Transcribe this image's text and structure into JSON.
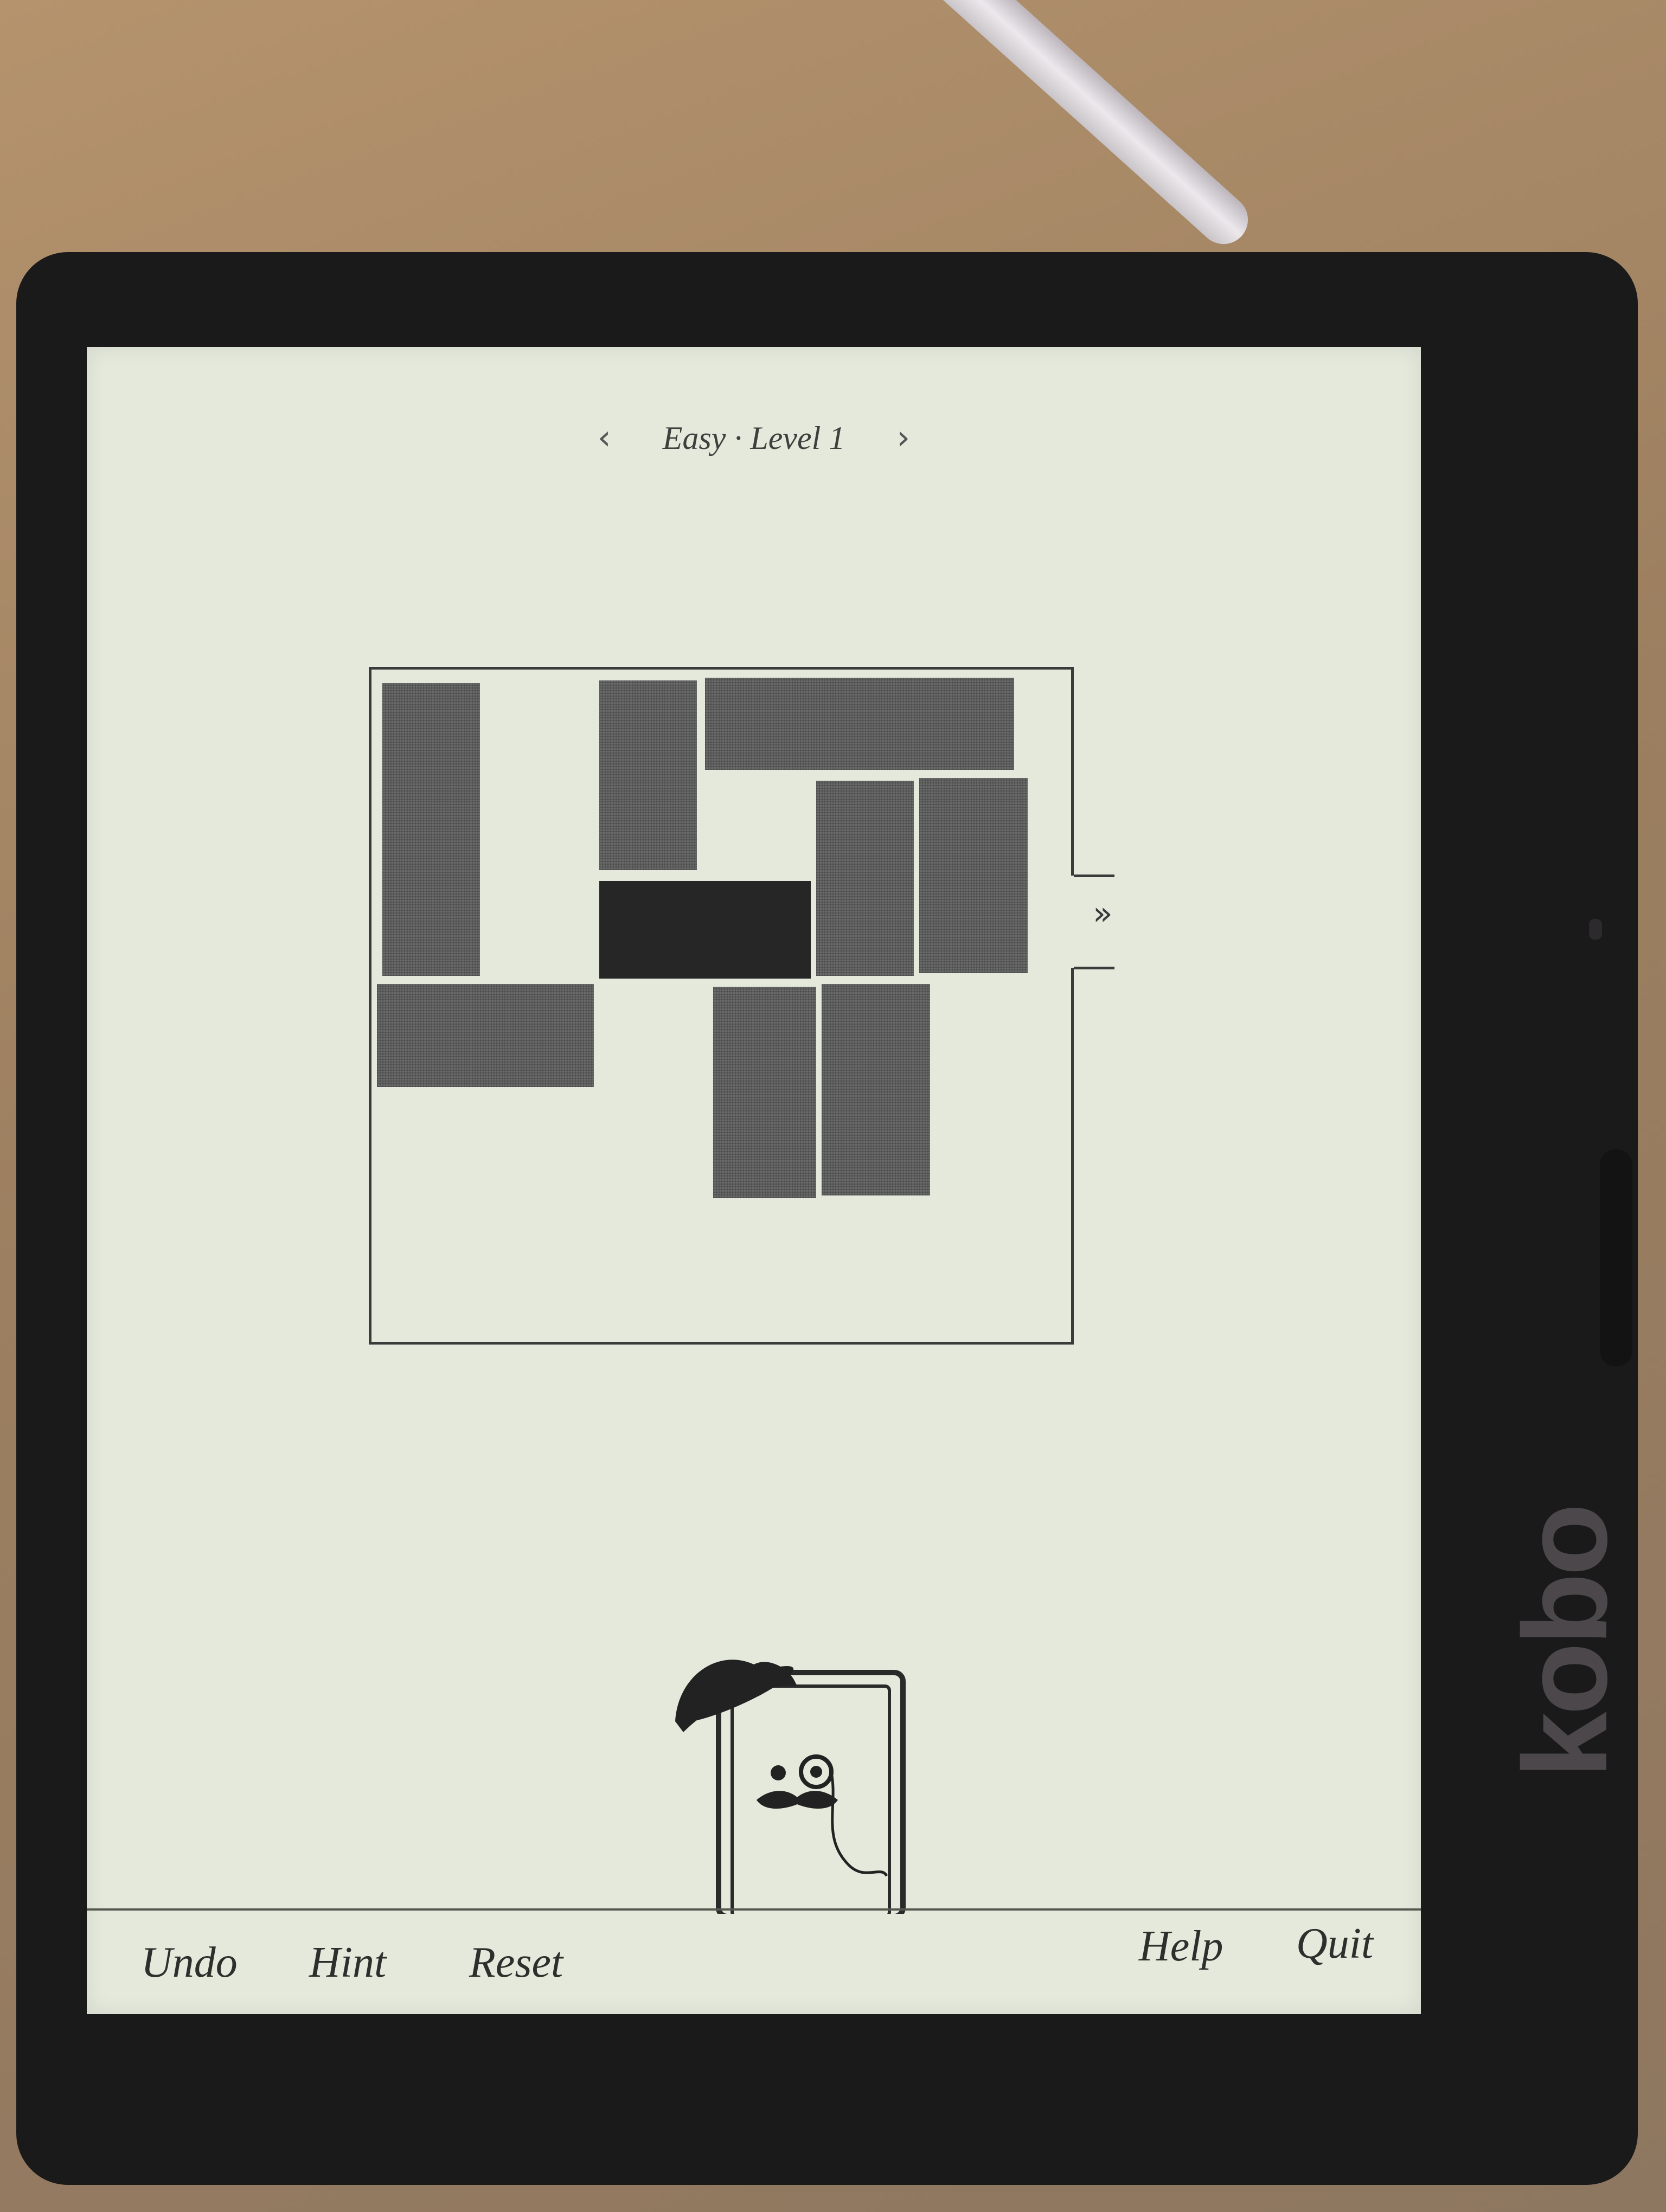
{
  "device": {
    "brand": "kobo"
  },
  "header": {
    "prev_icon": "chevron-left-icon",
    "prev_glyph": "‹",
    "title": "Easy · Level 1",
    "next_icon": "chevron-right-icon",
    "next_glyph": "›"
  },
  "board": {
    "exit_marker": "»",
    "colors": {
      "block": "#6a6a6a",
      "target_block": "#262626"
    }
  },
  "mascot": {
    "icon": "monocle-gentleman-mascot-icon"
  },
  "toolbar": {
    "undo_label": "Undo",
    "hint_label": "Hint",
    "reset_label": "Reset",
    "help_label": "Help",
    "quit_label": "Quit"
  }
}
